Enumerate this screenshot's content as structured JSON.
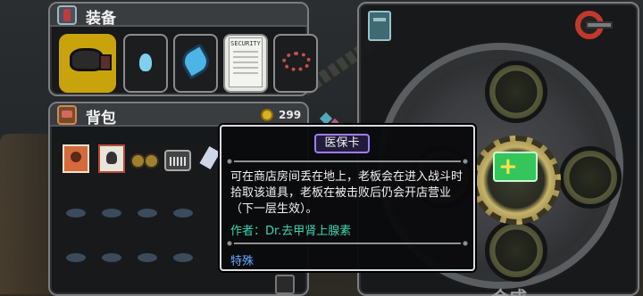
{
  "equipment": {
    "title": "装备",
    "slots": [
      {
        "name": "weapon",
        "icon": "armored-helmet-weapon-icon"
      },
      {
        "name": "fairy",
        "icon": "fairy-icon"
      },
      {
        "name": "skill",
        "icon": "crystal-blade-icon"
      },
      {
        "name": "card",
        "icon": "security-card-icon"
      },
      {
        "name": "accessory",
        "icon": "red-chain-icon"
      }
    ]
  },
  "bag": {
    "title": "背包",
    "coins": "299",
    "items": [
      "wanted-poster-icon",
      "skull-poster-icon",
      "goggles-icon",
      "device-icon",
      "robot-icon",
      "green-orb-icon"
    ]
  },
  "crafting": {
    "label": "合成",
    "plus_symbol": "+"
  },
  "tooltip": {
    "title": "医保卡",
    "description": "可在商店房间丢在地上，老板会在进入战斗时拾取该道具，老板在被击败后仍会开店营业（下一层生效）。",
    "author": "作者：Dr.去甲肾上腺素",
    "category": "特殊"
  },
  "colors": {
    "gold": "#c9a30c",
    "author_text": "#3fd6b0",
    "category_text": "#6aa9ff",
    "title_border": "#a07dff",
    "craft_green": "#36c55a"
  }
}
